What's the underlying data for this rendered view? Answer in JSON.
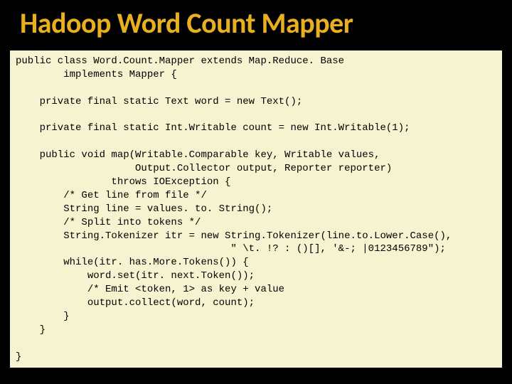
{
  "header": {
    "title": "Hadoop Word Count Mapper"
  },
  "code": {
    "lines": [
      "public class Word.Count.Mapper extends Map.Reduce. Base",
      "        implements Mapper {",
      "",
      "    private final static Text word = new Text();",
      "",
      "    private final static Int.Writable count = new Int.Writable(1);",
      "",
      "    public void map(Writable.Comparable key, Writable values,",
      "                    Output.Collector output, Reporter reporter)",
      "                throws IOException {",
      "        /* Get line from file */",
      "        String line = values. to. String();",
      "        /* Split into tokens */",
      "        String.Tokenizer itr = new String.Tokenizer(line.to.Lower.Case(),",
      "                                    \" \\t. !? : ()[], '&-; |0123456789\");",
      "        while(itr. has.More.Tokens()) {",
      "            word.set(itr. next.Token());",
      "            /* Emit <token, 1> as key + value",
      "            output.collect(word, count);",
      "        }",
      "    }",
      "",
      "}"
    ]
  }
}
